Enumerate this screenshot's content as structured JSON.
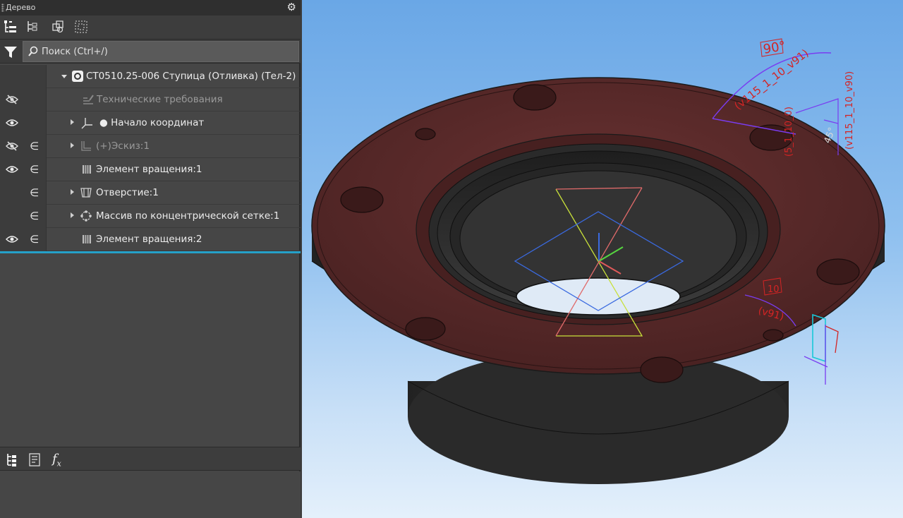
{
  "panel": {
    "title": "Дерево",
    "search": {
      "placeholder": "Поиск (Ctrl+/)"
    }
  },
  "tree": {
    "root_label": "СТ0510.25-006 Ступица (Отливка) (Тел-2)",
    "items": [
      {
        "label": "Технические требования",
        "visible": null,
        "included": false,
        "dim": true
      },
      {
        "label": "● Начало координат",
        "visible": true,
        "included": false,
        "dim": false
      },
      {
        "label": "(+)Эскиз:1",
        "visible": false,
        "included": true,
        "dim": true
      },
      {
        "label": "Элемент вращения:1",
        "visible": true,
        "included": true,
        "dim": false
      },
      {
        "label": "Отверстие:1",
        "visible": null,
        "included": true,
        "dim": false
      },
      {
        "label": "Массив по концентрической сетке:1",
        "visible": null,
        "included": true,
        "dim": false
      },
      {
        "label": "Элемент вращения:2",
        "visible": true,
        "included": true,
        "dim": false
      }
    ],
    "include_symbol": "∈"
  },
  "bottombar": {
    "fx_label": "f",
    "fx_sub": "x"
  },
  "annotations": {
    "angle_top": "90°",
    "callout_a": "(v115_1_10_v91)",
    "callout_b": "(v115_1_10_v90)",
    "callout_c": "(5_1_10_0)",
    "angle_small": "45°",
    "callout_d": "10",
    "callout_e": "(v91)"
  },
  "colors": {
    "accent": "#25a0c8",
    "part_face": "#5a2a2a",
    "part_body": "#2b2b2b",
    "annotation_red": "#d42424",
    "annotation_purple": "#7a3cf0",
    "annotation_cyan": "#18c8d8"
  }
}
